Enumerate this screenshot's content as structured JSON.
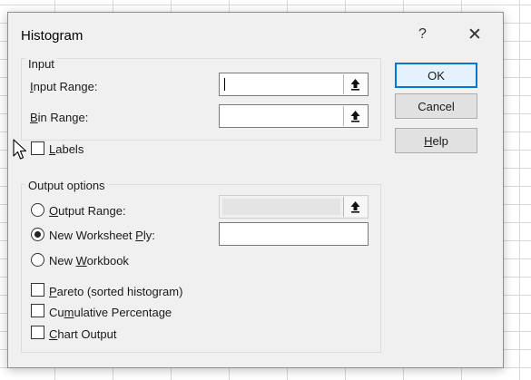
{
  "dialog": {
    "title": "Histogram",
    "help_glyph": "?",
    "close_glyph": "✕"
  },
  "input_group": {
    "legend": "Input",
    "input_range": {
      "label_prefix": "",
      "label_accel": "I",
      "label_rest": "nput Range:",
      "value": ""
    },
    "bin_range": {
      "label_prefix": "",
      "label_accel": "B",
      "label_rest": "in Range:",
      "value": ""
    },
    "labels": {
      "label_prefix": "",
      "label_accel": "L",
      "label_rest": "abels",
      "checked": false
    }
  },
  "output_group": {
    "legend": "Output options",
    "output_range": {
      "label_prefix": "",
      "label_accel": "O",
      "label_rest": "utput Range:",
      "selected": false,
      "value": ""
    },
    "new_worksheet": {
      "label_prefix": "New Worksheet ",
      "label_accel": "P",
      "label_rest": "ly:",
      "selected": true,
      "value": ""
    },
    "new_workbook": {
      "label_prefix": "New ",
      "label_accel": "W",
      "label_rest": "orkbook",
      "selected": false
    },
    "pareto": {
      "label_prefix": "",
      "label_accel": "P",
      "label_rest": "areto (sorted histogram)",
      "checked": false
    },
    "cumulative": {
      "label_prefix": "Cu",
      "label_accel": "m",
      "label_rest": "ulative Percentage",
      "checked": false
    },
    "chart_output": {
      "label_prefix": "",
      "label_accel": "C",
      "label_rest": "hart Output",
      "checked": false
    }
  },
  "buttons": {
    "ok": "OK",
    "cancel": "Cancel",
    "help_prefix": "",
    "help_accel": "H",
    "help_rest": "elp"
  },
  "icons": {
    "range_selector": "collapse-dialog-arrow-icon",
    "pointer": "mouse-cursor-icon"
  },
  "colors": {
    "dialog_bg": "#f0f0f0",
    "default_button_border": "#0078d7",
    "default_button_bg": "#e5f1fb"
  }
}
